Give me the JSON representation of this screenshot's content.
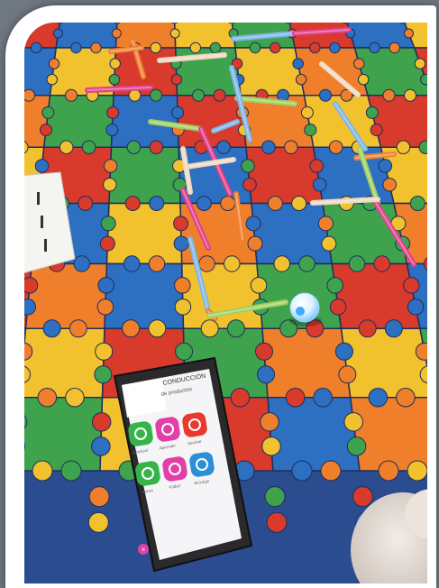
{
  "image": {
    "scene": "robot-coding-floor-mat",
    "frame_color": "#ffffff",
    "mat_colors": [
      "#d83a2c",
      "#f2c12e",
      "#2d6fc0",
      "#3fa34d",
      "#ef7f2a"
    ],
    "marker_colors": [
      "#e23f8d",
      "#f0d8c0",
      "#7db6e8",
      "#f08030",
      "#a0d060"
    ]
  },
  "tablet": {
    "header": "CONDUCCIÓN",
    "subheader": "de productos",
    "apps": [
      {
        "label": "Conducir",
        "color": "#36b44a",
        "icon": "gauge-icon"
      },
      {
        "label": "Aprender",
        "color": "#e040a8",
        "icon": "arrow-down-icon"
      },
      {
        "label": "Apuntar",
        "color": "#e8392e",
        "icon": "target-icon"
      },
      {
        "label": "Voces",
        "color": "#36b44a",
        "icon": "person-sound-icon"
      },
      {
        "label": "Fútbol",
        "color": "#e040a8",
        "icon": "ball-icon"
      },
      {
        "label": "Mi juego",
        "color": "#2a8fd6",
        "icon": "grid-icon"
      }
    ],
    "close_icon": "close-icon"
  }
}
